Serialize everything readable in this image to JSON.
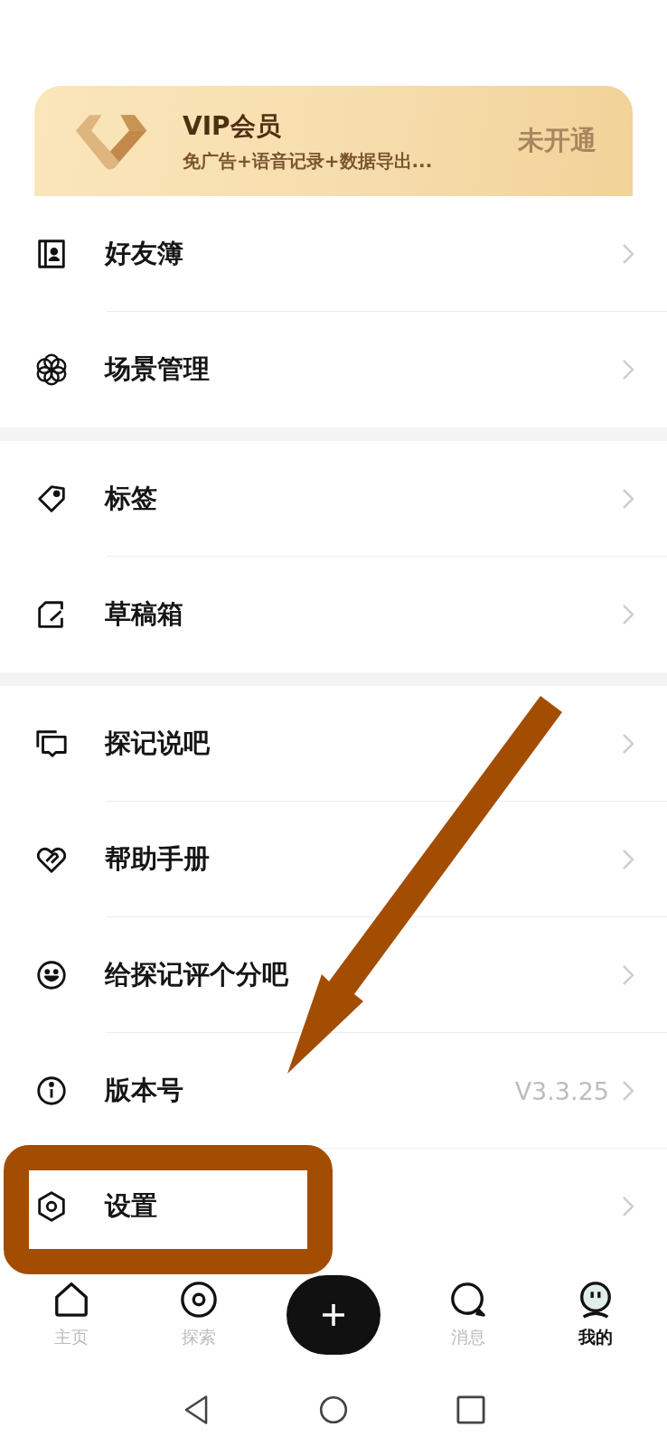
{
  "vip_card": {
    "title": "VIP会员",
    "subtitle": "免广告+语音记录+数据导出...",
    "status": "未开通"
  },
  "sections": [
    {
      "items": [
        {
          "label": "好友簿"
        },
        {
          "label": "场景管理"
        }
      ]
    },
    {
      "items": [
        {
          "label": "标签"
        },
        {
          "label": "草稿箱"
        }
      ]
    },
    {
      "items": [
        {
          "label": "探记说吧"
        },
        {
          "label": "帮助手册"
        },
        {
          "label": "给探记评个分吧"
        },
        {
          "label": "版本号",
          "value": "V3.3.25"
        },
        {
          "label": "设置"
        }
      ]
    }
  ],
  "tab_bar": [
    {
      "label": "主页",
      "selected": false
    },
    {
      "label": "探索",
      "selected": false
    },
    {
      "kind": "add"
    },
    {
      "label": "消息",
      "selected": false
    },
    {
      "label": "我的",
      "selected": true
    }
  ]
}
